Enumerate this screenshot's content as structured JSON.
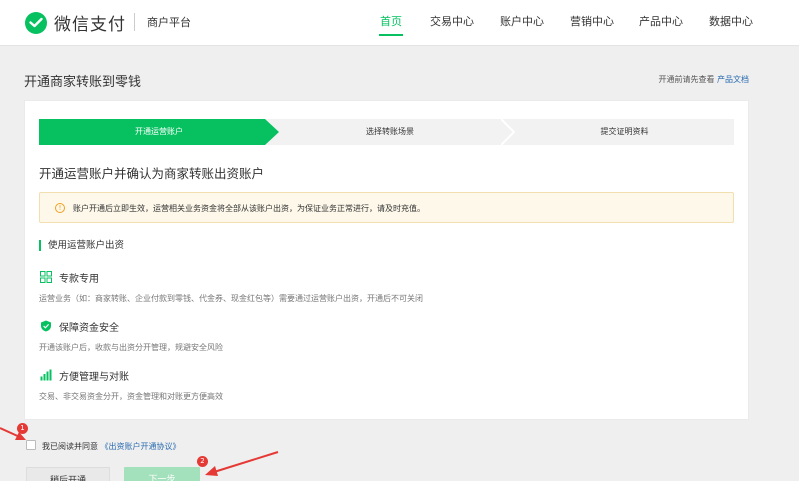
{
  "header": {
    "brand": "微信支付",
    "platform": "商户平台",
    "nav": [
      "首页",
      "交易中心",
      "账户中心",
      "营销中心",
      "产品中心",
      "数据中心"
    ],
    "active_nav": "首页"
  },
  "page": {
    "title": "开通商家转账到零钱",
    "doc_hint": "开通前请先查看",
    "doc_link": "产品文档"
  },
  "steps": [
    "开通运营账户",
    "选择转账场景",
    "提交证明资料"
  ],
  "section_title": "开通运营账户并确认为商家转账出资账户",
  "notice": "账户开通后立即生效，运营相关业务资金将全部从该账户出资，为保证业务正常进行，请及时充值。",
  "sub_title": "使用运营账户出资",
  "features": [
    {
      "title": "专款专用",
      "desc": "运营业务（如：商家转账、企业付款到零钱、代金券、现金红包等）需要通过运营账户出资，开通后不可关闭"
    },
    {
      "title": "保障资金安全",
      "desc": "开通该账户后，收款与出资分开管理，规避安全风险"
    },
    {
      "title": "方便管理与对账",
      "desc": "交易、非交易资金分开，资金管理和对账更方便高效"
    }
  ],
  "agreement": {
    "text": "我已阅读并同意",
    "link": "《出资账户开通协议》"
  },
  "buttons": {
    "later": "稍后开通",
    "next": "下一步"
  },
  "annotations": [
    "1",
    "2"
  ],
  "colors": {
    "brand_green": "#07c160",
    "link_blue": "#2b6cb0",
    "annotation_red": "#e53935"
  }
}
